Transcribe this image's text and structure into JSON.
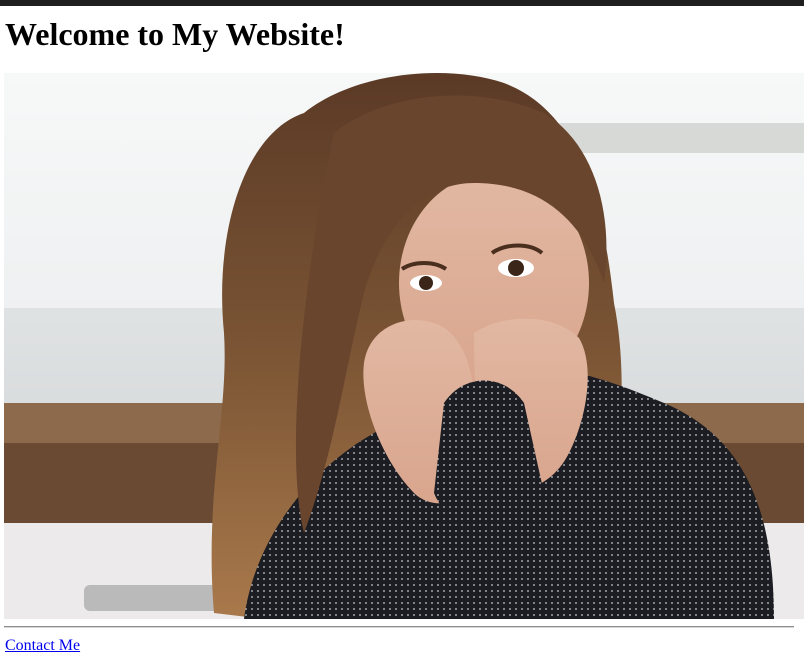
{
  "page": {
    "title": "Welcome to My Website!"
  },
  "hero_image": {
    "alt": "woman-with-sweater-photo"
  },
  "footer": {
    "contact_label": "Contact Me"
  },
  "colors": {
    "top_bar": "#1f1f1f",
    "link": "#0000ee"
  }
}
